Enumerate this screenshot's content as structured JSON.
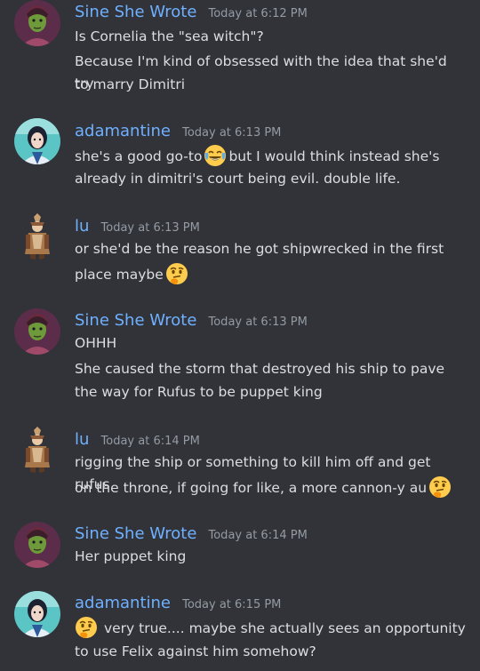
{
  "messages": [
    {
      "author": "Sine She Wrote",
      "timestamp": "Today at 6:12 PM",
      "avatar": "green-skinned-character-avatar",
      "lines": [
        "Is Cornelia the \"sea witch\"?",
        "Because I'm kind of obsessed with the idea that she'd try",
        "to marry Dimitri"
      ]
    },
    {
      "author": "adamantine",
      "timestamp": "Today at 6:13 PM",
      "avatar": "dark-haired-character-avatar",
      "lines": [
        {
          "before": "she's a good go-to",
          "emoji": "joy-emoji",
          "after": "but I would think instead she's"
        },
        "already in dimitri's court being evil. double life."
      ]
    },
    {
      "author": "lu",
      "timestamp": "Today at 6:13 PM",
      "avatar": "costumed-figure-avatar",
      "lines": [
        "or she'd be the reason he got shipwrecked in the first",
        {
          "before": "place maybe",
          "emoji": "thinking-emoji",
          "after": ""
        }
      ]
    },
    {
      "author": "Sine She Wrote",
      "timestamp": "Today at 6:13 PM",
      "avatar": "green-skinned-character-avatar",
      "lines": [
        "OHHH",
        "She caused the storm that destroyed his ship to pave",
        "the way for Rufus to be puppet king"
      ]
    },
    {
      "author": "lu",
      "timestamp": "Today at 6:14 PM",
      "avatar": "costumed-figure-avatar",
      "lines": [
        "rigging the ship or something to kill him off and get rufus",
        {
          "before": "on the throne, if going for like, a more cannon-y au",
          "emoji": "thinking-emoji",
          "after": ""
        }
      ]
    },
    {
      "author": "Sine She Wrote",
      "timestamp": "Today at 6:14 PM",
      "avatar": "green-skinned-character-avatar",
      "lines": [
        "Her puppet king"
      ]
    },
    {
      "author": "adamantine",
      "timestamp": "Today at 6:15 PM",
      "avatar": "dark-haired-character-avatar",
      "lines": [
        {
          "before": "",
          "emoji": "thinking-emoji",
          "after": "very true.... maybe she actually sees an opportunity"
        },
        "to use Felix against him somehow?"
      ]
    }
  ],
  "colors": {
    "background": "#313338",
    "username": "#6fb0ff",
    "timestamp": "#949ba4",
    "text": "#dbdee1"
  }
}
